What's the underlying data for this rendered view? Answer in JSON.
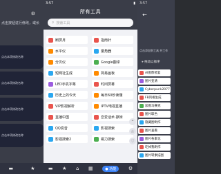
{
  "left": {
    "status_time": "",
    "note": "点击按钮进行修改，或长",
    "cards": [
      "点击本项修改名称",
      "点击本项修改名称",
      "点击本项修改名称",
      "点击本项修改名称"
    ],
    "nav": [
      "archive-icon",
      "star-icon"
    ]
  },
  "middle": {
    "status_time": "3:57",
    "title": "所有工具",
    "search_placeholder": "搜索工具",
    "tools": [
      {
        "label": "刷屏月",
        "color": "#e9544d"
      },
      {
        "label": "指南针",
        "color": "#e9544d"
      },
      {
        "label": "水平仪",
        "color": "#ff8a00"
      },
      {
        "label": "量角器",
        "color": "#2aa7f0"
      },
      {
        "label": "分贝仪",
        "color": "#ff8a00"
      },
      {
        "label": "Google翻译",
        "color": "#4caf50"
      },
      {
        "label": "短网址生成",
        "color": "#2aa7f0"
      },
      {
        "label": "简易画板",
        "color": "#ff8a00"
      },
      {
        "label": "LED手机字幕",
        "color": "#9c5ce0"
      },
      {
        "label": "时间屏幕",
        "color": "#e9544d"
      },
      {
        "label": "历史上的今天",
        "color": "#2aa7f0"
      },
      {
        "label": "每日60秒读懂",
        "color": "#ff8a00"
      },
      {
        "label": "VIP影视解析",
        "color": "#e9544d"
      },
      {
        "label": "IPTV电视直播",
        "color": "#ff8a00"
      },
      {
        "label": "直播中国",
        "color": "#e9544d"
      },
      {
        "label": "恋爱话术·撩妹",
        "color": "#e9544d"
      },
      {
        "label": "QQ变音",
        "color": "#2aa7f0"
      },
      {
        "label": "影视搜索",
        "color": "#2aa7f0"
      },
      {
        "label": "影视搜索2",
        "color": "#2aa7f0"
      },
      {
        "label": "磁力搜索",
        "color": "#4caf50"
      }
    ],
    "side_icons": [
      "up-arrow-icon",
      "star-icon",
      "favorite-icon"
    ],
    "nav": [
      "archive-icon",
      "star-icon",
      "home-icon",
      "grid-icon",
      "功能",
      "settings-icon"
    ]
  },
  "right": {
    "status_time": "3:57",
    "note": "点击添加到工具 并工作",
    "sort_label": "⚹ 拖动以排序",
    "items": [
      {
        "label": "AI图像修复",
        "color": "#e9544d"
      },
      {
        "label": "图片变清",
        "color": "#9c5ce0"
      },
      {
        "label": "Cyberpunk2077",
        "color": "#2aa7f0"
      },
      {
        "label": "FB风格生成",
        "color": "#e9544d"
      },
      {
        "label": "加图马赛克",
        "color": "#4caf50"
      },
      {
        "label": "图片取色",
        "color": "#e9544d"
      },
      {
        "label": "隐藏图制作",
        "color": "#2aa7f0"
      },
      {
        "label": "图片查看",
        "color": "#e9544d"
      },
      {
        "label": "图片各素化",
        "color": "#9c5ce0"
      },
      {
        "label": "吃掉我制作",
        "color": "#e9544d"
      },
      {
        "label": "图片转素描图",
        "color": "#2aa7f0"
      }
    ]
  }
}
